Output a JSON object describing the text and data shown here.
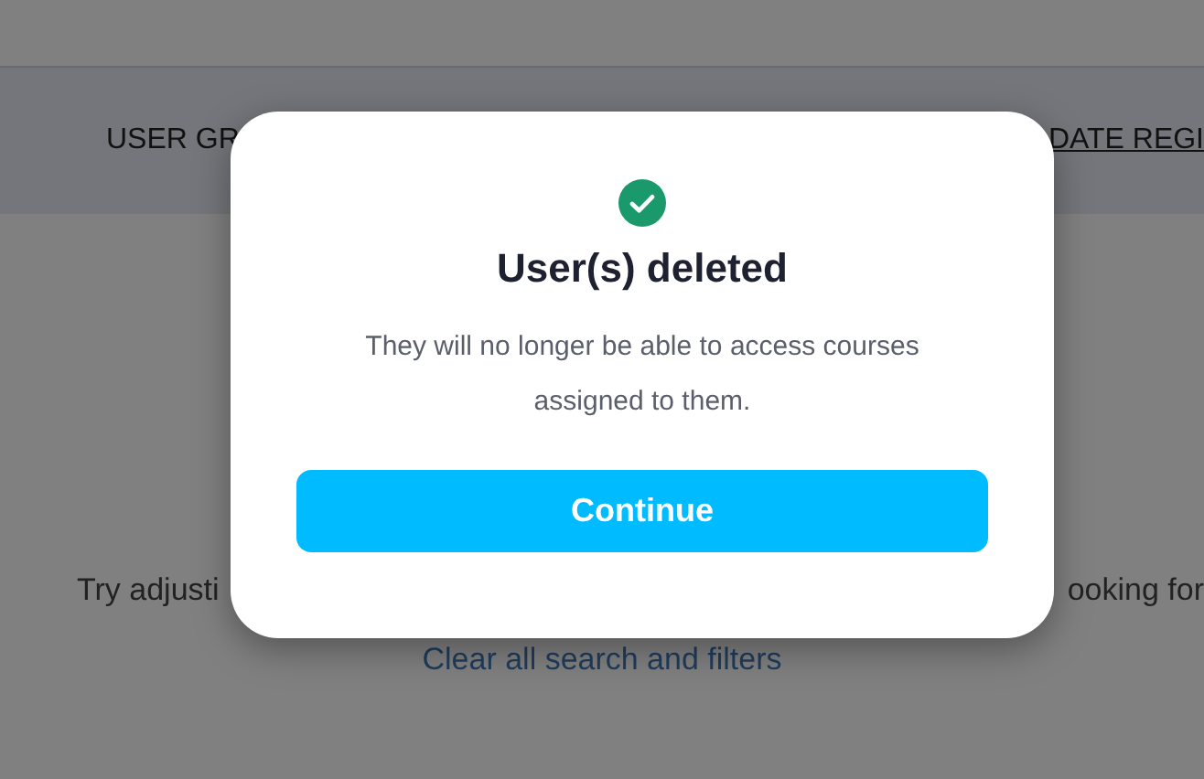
{
  "background": {
    "columns": [
      "USER GR",
      "DATE REGI"
    ],
    "empty_message_start": "Try adjusti",
    "empty_message_end": "ooking for",
    "clear_link": "Clear all search and filters"
  },
  "dialog": {
    "title": "User(s) deleted",
    "message": "They will no longer be able to access courses assigned to them.",
    "button": "Continue"
  }
}
